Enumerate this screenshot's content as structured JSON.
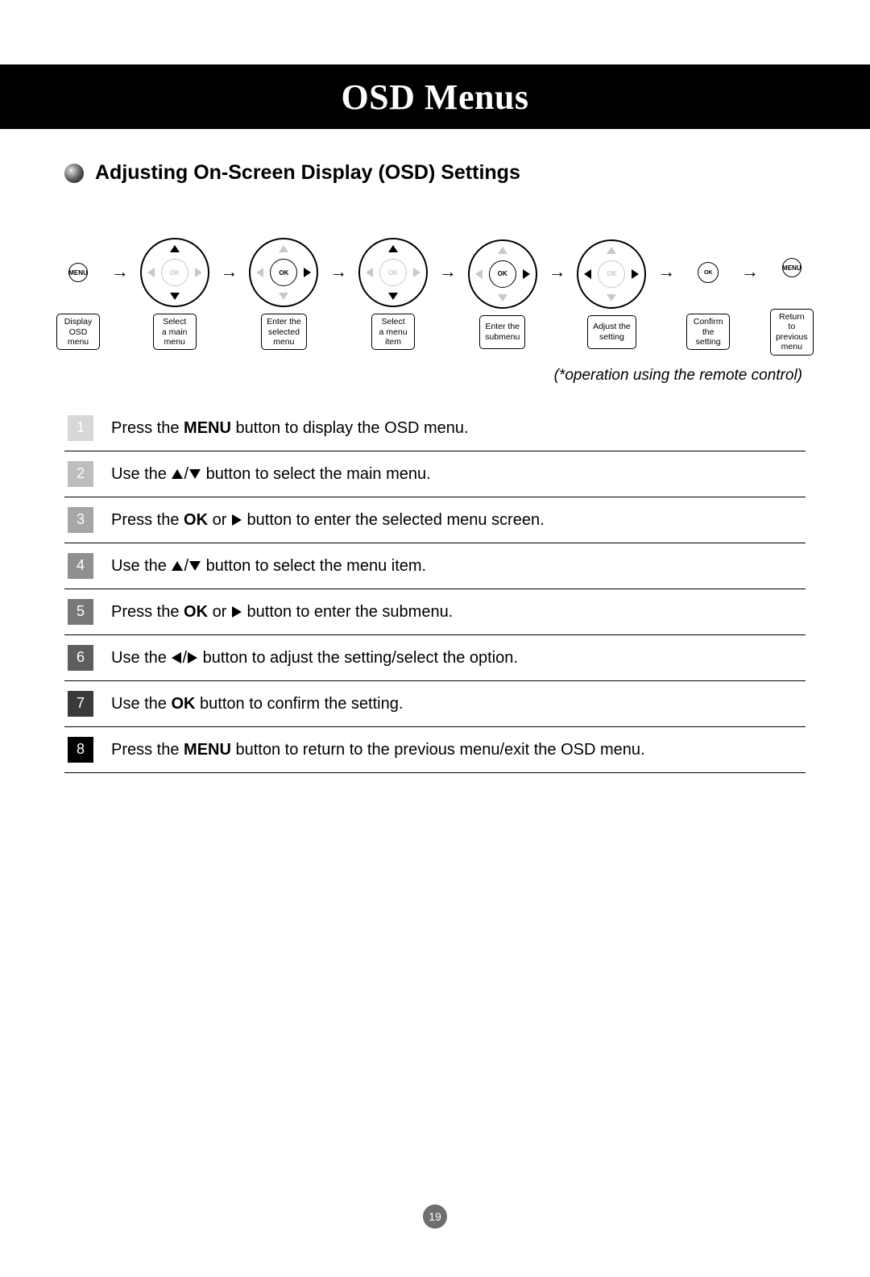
{
  "banner_title": "OSD Menus",
  "section_title": "Adjusting On-Screen Display (OSD) Settings",
  "dpad_ok_label": "OK",
  "menu_btn_label": "MENU",
  "flow": [
    {
      "kind": "menu",
      "caption": "Display\nOSD\nmenu"
    },
    {
      "kind": "dpad",
      "active": [
        "up",
        "down"
      ],
      "ok_active": false,
      "caption": "Select\na main\nmenu"
    },
    {
      "kind": "dpad",
      "active": [
        "right"
      ],
      "ok_active": true,
      "caption": "Enter the\nselected\nmenu"
    },
    {
      "kind": "dpad",
      "active": [
        "up",
        "down"
      ],
      "ok_active": false,
      "caption": "Select\na menu\nitem"
    },
    {
      "kind": "dpad",
      "active": [
        "right"
      ],
      "ok_active": true,
      "caption": "Enter the\nsubmenu"
    },
    {
      "kind": "dpad",
      "active": [
        "left",
        "right"
      ],
      "ok_active": false,
      "caption": "Adjust the\nsetting"
    },
    {
      "kind": "ok",
      "caption": "Confirm\nthe\nsetting"
    },
    {
      "kind": "menu",
      "caption": "Return\nto\nprevious\nmenu"
    }
  ],
  "note": "(*operation using the remote control)",
  "steps": [
    {
      "n": "1",
      "shade": "shade-1",
      "html": "Press the <span class='b'>MENU</span> button to display the OSD menu."
    },
    {
      "n": "2",
      "shade": "shade-2",
      "html": "Use the <span class='tri-inline up'></span>/<span class='tri-inline down'></span> button to select the main menu."
    },
    {
      "n": "3",
      "shade": "shade-3",
      "html": "Press the <span class='b'>OK</span> or <span class='tri-inline right'></span> button to enter the selected menu screen."
    },
    {
      "n": "4",
      "shade": "shade-4",
      "html": "Use the <span class='tri-inline up'></span>/<span class='tri-inline down'></span> button to select the menu item."
    },
    {
      "n": "5",
      "shade": "shade-5",
      "html": "Press the <span class='b'>OK</span> or <span class='tri-inline right'></span> button to enter the submenu."
    },
    {
      "n": "6",
      "shade": "shade-6",
      "html": "Use the <span class='tri-inline left'></span>/<span class='tri-inline right'></span> button to adjust the setting/select the option."
    },
    {
      "n": "7",
      "shade": "shade-7",
      "html": "Use the <span class='b'>OK</span> button to confirm the setting."
    },
    {
      "n": "8",
      "shade": "shade-8",
      "html": "Press the <span class='b'>MENU</span> button to return to the previous menu/exit the OSD menu."
    }
  ],
  "page_number": "19"
}
